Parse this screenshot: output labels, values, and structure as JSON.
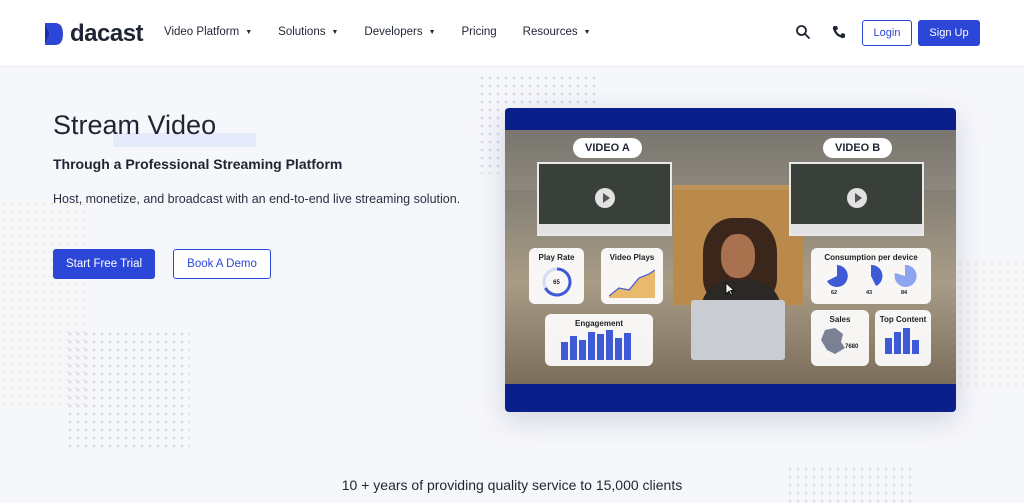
{
  "brand": {
    "name": "dacast",
    "color": "#2c46d8"
  },
  "nav": {
    "items": [
      {
        "label": "Video Platform",
        "has_dropdown": true
      },
      {
        "label": "Solutions",
        "has_dropdown": true
      },
      {
        "label": "Developers",
        "has_dropdown": true
      },
      {
        "label": "Pricing",
        "has_dropdown": false
      },
      {
        "label": "Resources",
        "has_dropdown": true
      }
    ],
    "search_icon": "search-icon",
    "phone_icon": "phone-icon",
    "login_label": "Login",
    "signup_label": "Sign Up"
  },
  "hero": {
    "title": "Stream Video",
    "subtitle": "Through a Professional Streaming Platform",
    "description": "Host, monetize, and broadcast with an end-to-end live streaming solution.",
    "primary_cta": "Start Free Trial",
    "secondary_cta": "Book A Demo"
  },
  "media": {
    "video_a_label": "VIDEO A",
    "video_b_label": "VIDEO B",
    "cards": {
      "play_rate": {
        "title": "Play Rate",
        "value": "65"
      },
      "video_plays": {
        "title": "Video Plays"
      },
      "engagement": {
        "title": "Engagement"
      },
      "consumption": {
        "title": "Consumption per device",
        "values": [
          "62",
          "43",
          "84"
        ]
      },
      "sales": {
        "title": "Sales",
        "value": "7680"
      },
      "top_content": {
        "title": "Top Content"
      }
    }
  },
  "footer": {
    "tagline": "10 + years of providing quality service to 15,000 clients"
  }
}
